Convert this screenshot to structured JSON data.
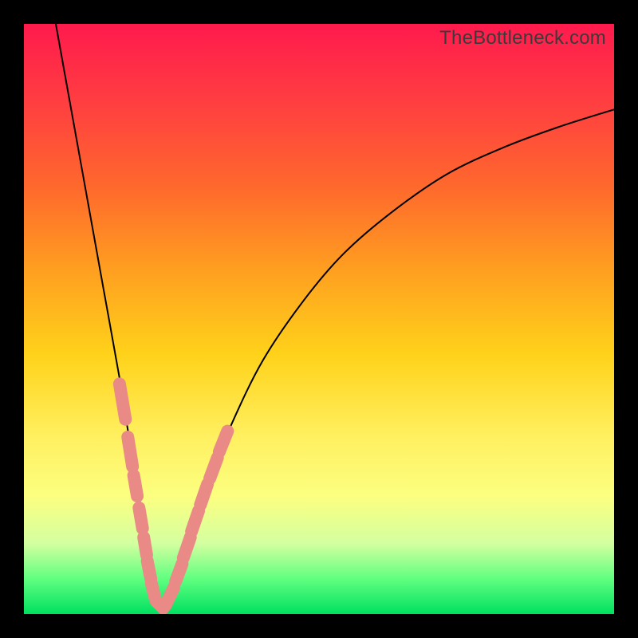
{
  "watermark": "TheBottleneck.com",
  "chart_data": {
    "type": "line",
    "title": "",
    "xlabel": "",
    "ylabel": "",
    "xlim": [
      0,
      100
    ],
    "ylim": [
      0,
      100
    ],
    "grid": false,
    "legend": false,
    "curve_left": {
      "description": "Steep descending branch from top-left into trough at ~x=22",
      "points": [
        {
          "x": 5.4,
          "y": 100
        },
        {
          "x": 8.1,
          "y": 85
        },
        {
          "x": 10.8,
          "y": 70
        },
        {
          "x": 13.5,
          "y": 55
        },
        {
          "x": 16.2,
          "y": 40
        },
        {
          "x": 17.8,
          "y": 30
        },
        {
          "x": 19.5,
          "y": 20
        },
        {
          "x": 21.1,
          "y": 10
        },
        {
          "x": 22.3,
          "y": 4
        },
        {
          "x": 23.2,
          "y": 0.8
        }
      ]
    },
    "curve_right": {
      "description": "Rising branch from trough toward upper right, asymptotic",
      "points": [
        {
          "x": 23.2,
          "y": 0.8
        },
        {
          "x": 25.7,
          "y": 6
        },
        {
          "x": 28.4,
          "y": 14
        },
        {
          "x": 31.1,
          "y": 22
        },
        {
          "x": 35.1,
          "y": 32
        },
        {
          "x": 40.5,
          "y": 43
        },
        {
          "x": 47.3,
          "y": 53
        },
        {
          "x": 54.1,
          "y": 61
        },
        {
          "x": 62.2,
          "y": 68
        },
        {
          "x": 71.6,
          "y": 74.5
        },
        {
          "x": 81.1,
          "y": 79
        },
        {
          "x": 90.5,
          "y": 82.5
        },
        {
          "x": 100,
          "y": 85.5
        }
      ]
    },
    "markers": {
      "description": "Salmon capsule segments clustered near the trough along both branches",
      "color": "#e98a86",
      "segments": [
        {
          "x1": 16.2,
          "y1": 39,
          "x2": 17.2,
          "y2": 33
        },
        {
          "x1": 17.6,
          "y1": 30,
          "x2": 18.4,
          "y2": 25
        },
        {
          "x1": 18.6,
          "y1": 23.5,
          "x2": 19.2,
          "y2": 20
        },
        {
          "x1": 19.5,
          "y1": 18,
          "x2": 20.1,
          "y2": 14.5
        },
        {
          "x1": 20.3,
          "y1": 13,
          "x2": 20.8,
          "y2": 10
        },
        {
          "x1": 20.9,
          "y1": 9,
          "x2": 21.5,
          "y2": 6
        },
        {
          "x1": 21.6,
          "y1": 5.2,
          "x2": 22.2,
          "y2": 2.8
        },
        {
          "x1": 22.4,
          "y1": 2.2,
          "x2": 23.6,
          "y2": 1.0
        },
        {
          "x1": 24.0,
          "y1": 1.5,
          "x2": 25.4,
          "y2": 4.5
        },
        {
          "x1": 25.7,
          "y1": 5.5,
          "x2": 26.8,
          "y2": 8.5
        },
        {
          "x1": 27.0,
          "y1": 9.5,
          "x2": 28.2,
          "y2": 13
        },
        {
          "x1": 28.4,
          "y1": 14,
          "x2": 29.6,
          "y2": 17.5
        },
        {
          "x1": 29.9,
          "y1": 18.5,
          "x2": 31.1,
          "y2": 22
        },
        {
          "x1": 31.5,
          "y1": 23,
          "x2": 32.8,
          "y2": 26.5
        },
        {
          "x1": 33.1,
          "y1": 27.5,
          "x2": 34.5,
          "y2": 31
        }
      ]
    }
  }
}
